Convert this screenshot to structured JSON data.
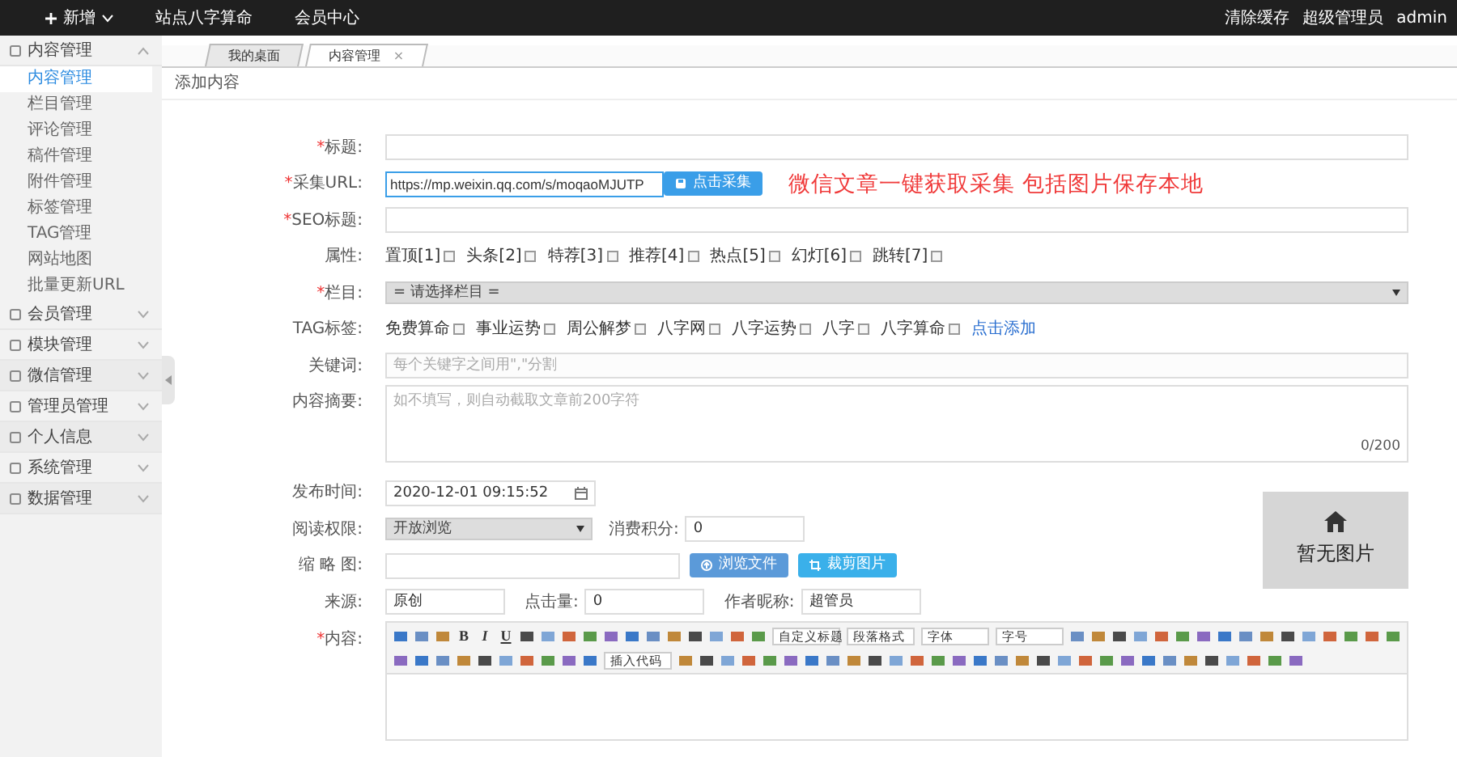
{
  "topbar": {
    "menus": [
      {
        "label": "新增",
        "kind": "add"
      },
      {
        "label": "站点八字算命",
        "kind": "plain"
      },
      {
        "label": "会员中心",
        "kind": "plain"
      }
    ],
    "right": [
      "清除缓存",
      "超级管理员",
      "admin"
    ]
  },
  "sidebar": {
    "groups": [
      {
        "label": "内容管理",
        "expanded": true,
        "children": [
          {
            "label": "内容管理",
            "selected": true
          },
          {
            "label": "栏目管理",
            "selected": false
          },
          {
            "label": "评论管理",
            "selected": false
          },
          {
            "label": "稿件管理",
            "selected": false
          },
          {
            "label": "附件管理",
            "selected": false
          },
          {
            "label": "标签管理",
            "selected": false
          },
          {
            "label": "TAG管理",
            "selected": false
          },
          {
            "label": "网站地图",
            "selected": false
          },
          {
            "label": "批量更新URL",
            "selected": false
          }
        ]
      },
      {
        "label": "会员管理",
        "expanded": false
      },
      {
        "label": "模块管理",
        "expanded": false
      },
      {
        "label": "微信管理",
        "expanded": false
      },
      {
        "label": "管理员管理",
        "expanded": false
      },
      {
        "label": "个人信息",
        "expanded": false
      },
      {
        "label": "系统管理",
        "expanded": false
      },
      {
        "label": "数据管理",
        "expanded": false
      }
    ]
  },
  "tabs": [
    {
      "label": "我的桌面",
      "selected": false
    },
    {
      "label": "内容管理",
      "selected": true,
      "close": "×"
    }
  ],
  "breadcrumb": "添加内容",
  "form": {
    "fields": [
      {
        "kind": "text",
        "label": "标题:",
        "required_mark": "*"
      },
      {
        "kind": "url",
        "label": "采集URL:",
        "required_mark": "*",
        "value": "https://mp.weixin.qq.com/s/moqaoMJUTP",
        "button": "点击采集",
        "note": "微信文章一键获取采集 包括图片保存本地"
      },
      {
        "kind": "text",
        "label": "SEO标题:",
        "required_mark": "*"
      },
      {
        "kind": "checks",
        "label": "属性:",
        "options": [
          {
            "label": "置顶[1]",
            "checked": false
          },
          {
            "label": "头条[2]",
            "checked": false
          },
          {
            "label": "特荐[3]",
            "checked": false
          },
          {
            "label": "推荐[4]",
            "checked": false
          },
          {
            "label": "热点[5]",
            "checked": false
          },
          {
            "label": "幻灯[6]",
            "checked": false
          },
          {
            "label": "跳转[7]",
            "checked": false
          }
        ]
      },
      {
        "kind": "select",
        "label": "栏目:",
        "required_mark": "*",
        "value": "= 请选择栏目 ="
      },
      {
        "kind": "checks",
        "label": "TAG标签:",
        "options": [
          {
            "label": "免费算命",
            "checked": false
          },
          {
            "label": "事业运势",
            "checked": false
          },
          {
            "label": "周公解梦",
            "checked": false
          },
          {
            "label": "八字网",
            "checked": false
          },
          {
            "label": "八字运势",
            "checked": false
          },
          {
            "label": "八字",
            "checked": false
          },
          {
            "label": "八字算命",
            "checked": false
          }
        ],
        "link": "点击添加"
      },
      {
        "kind": "text",
        "label": "关键词:",
        "placeholder": "每个关键字之间用\",\"分割"
      },
      {
        "kind": "textarea",
        "label": "内容摘要:",
        "placeholder": "如不填写，则自动截取文章前200字符",
        "counter": "0/200"
      }
    ],
    "lower_fields": [
      {
        "kind": "datetime",
        "label": "发布时间:",
        "value": "2020-12-01 09:15:52"
      },
      {
        "kind": "permission",
        "label": "阅读权限:",
        "value": "开放浏览",
        "points_label": "消费积分:",
        "points": "0"
      },
      {
        "kind": "file",
        "label": "缩 略 图:",
        "buttons": [
          "浏览文件",
          "裁剪图片"
        ]
      },
      {
        "kind": "source",
        "label": "来源:",
        "value": "原创",
        "hits_label": "点击量:",
        "hits": "0",
        "author_label": "作者昵称:",
        "author": "超管员"
      }
    ],
    "preview": {
      "text": "暂无图片"
    },
    "editor": {
      "label": "内容:",
      "required_mark": "*",
      "letters": [
        "B",
        "I",
        "U"
      ],
      "selects": [
        "自定义标题",
        "段落格式",
        "字体",
        "字号"
      ],
      "code_select": "插入代码"
    }
  }
}
